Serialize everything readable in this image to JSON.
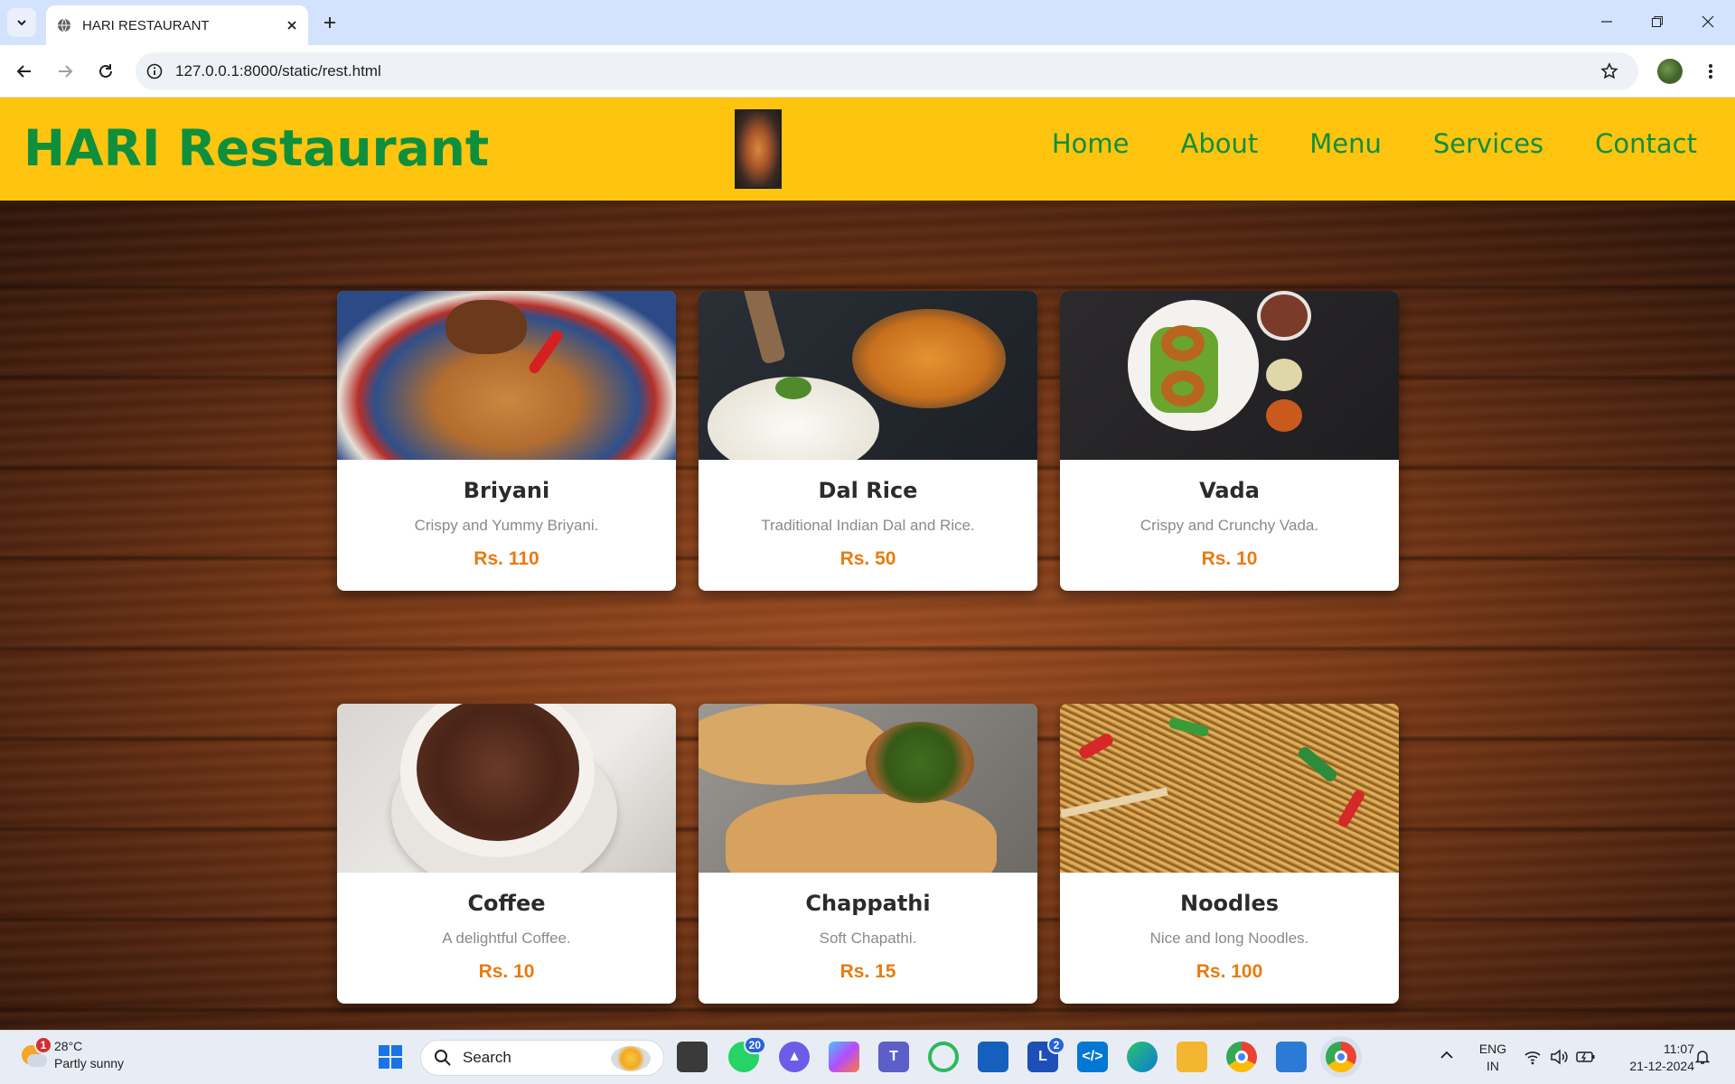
{
  "browser": {
    "tab_title": "HARI RESTAURANT",
    "url": "127.0.0.1:8000/static/rest.html"
  },
  "site": {
    "brand": "HARI Restaurant",
    "nav": [
      "Home",
      "About",
      "Menu",
      "Services",
      "Contact"
    ]
  },
  "menu_items": [
    {
      "name": "Briyani",
      "desc": "Crispy and Yummy Briyani.",
      "price": "Rs. 110"
    },
    {
      "name": "Dal Rice",
      "desc": "Traditional Indian Dal and Rice.",
      "price": "Rs. 50"
    },
    {
      "name": "Vada",
      "desc": "Crispy and Crunchy Vada.",
      "price": "Rs. 10"
    },
    {
      "name": "Coffee",
      "desc": "A delightful Coffee.",
      "price": "Rs. 10"
    },
    {
      "name": "Chappathi",
      "desc": "Soft Chapathi.",
      "price": "Rs. 15"
    },
    {
      "name": "Noodles",
      "desc": "Nice and long Noodles.",
      "price": "Rs. 100"
    }
  ],
  "taskbar": {
    "weather_temp": "28°C",
    "weather_desc": "Partly sunny",
    "weather_badge": "1",
    "search_label": "Search",
    "whatsapp_badge": "20",
    "l_app_badge": "2",
    "lang_line1": "ENG",
    "lang_line2": "IN",
    "time": "11:07",
    "date": "21-12-2024"
  },
  "colors": {
    "header_bg": "#fec40f",
    "brand_green": "#0f8f3c",
    "price_orange": "#e97a12"
  }
}
